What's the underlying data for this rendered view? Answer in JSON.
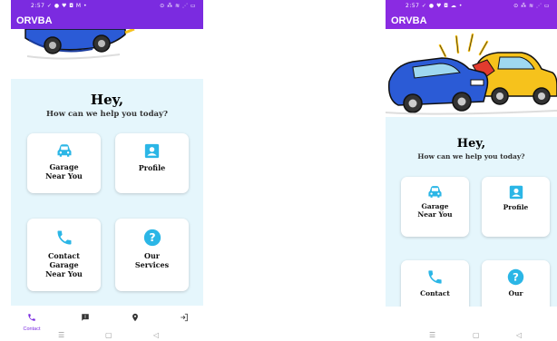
{
  "left": {
    "status": {
      "time": "2:57",
      "icons": "✓ ● ♥ ◘ M •",
      "right": "⊙ ⁂ ≋ ⋰ ▭"
    },
    "app_title": "ORVBA",
    "greeting": "Hey,",
    "subtitle": "How can we help you today?",
    "cards": [
      {
        "label_lines": [
          "Garage",
          "Near You"
        ],
        "icon": "car-icon"
      },
      {
        "label_lines": [
          "Profile"
        ],
        "icon": "profile-icon"
      },
      {
        "label_lines": [
          "Contact",
          "Garage",
          "Near You"
        ],
        "icon": "phone-icon"
      },
      {
        "label_lines": [
          "Our",
          "Services"
        ],
        "icon": "help-icon"
      }
    ],
    "nav": [
      {
        "icon": "phone-icon",
        "label": "Contact"
      },
      {
        "icon": "message-icon",
        "label": ""
      },
      {
        "icon": "location-icon",
        "label": ""
      },
      {
        "icon": "logout-icon",
        "label": ""
      }
    ]
  },
  "right": {
    "status": {
      "time": "2:57",
      "icons": "✓ ● ♥ ◘ ☁ •",
      "right": "⊙ ⁂ ≋ ⋰ ▭"
    },
    "app_title": "ORVBA",
    "greeting": "Hey,",
    "subtitle": "How can we help you today?",
    "cards": [
      {
        "label_lines": [
          "Garage",
          "Near You"
        ],
        "icon": "car-icon"
      },
      {
        "label_lines": [
          "Profile"
        ],
        "icon": "profile-icon"
      },
      {
        "label_lines": [
          "Contact"
        ],
        "icon": "phone-icon"
      },
      {
        "label_lines": [
          "Our"
        ],
        "icon": "help-icon"
      }
    ]
  },
  "colors": {
    "accent": "#7b2be0",
    "icon": "#2bb6e6",
    "content_bg": "#e5f6fc",
    "blue_car": "#2b5bd6",
    "yellow_car": "#f6c21c"
  },
  "sys_nav": {
    "menu": "☰",
    "home": "▢",
    "back": "◁"
  }
}
